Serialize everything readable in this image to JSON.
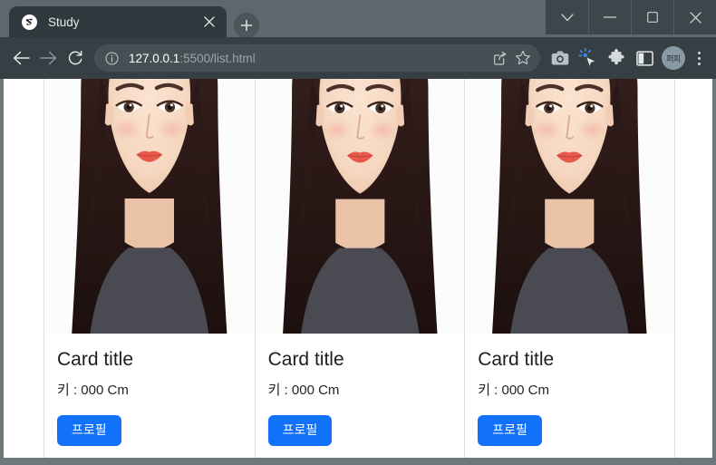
{
  "window": {
    "controls": [
      {
        "name": "chevron-down",
        "label": "⌄"
      },
      {
        "name": "minimize",
        "label": "—"
      },
      {
        "name": "maximize",
        "label": "□"
      },
      {
        "name": "close",
        "label": "✕"
      }
    ]
  },
  "tab": {
    "title": "Study",
    "favicon": "swirl-s-icon",
    "close_label": "✕",
    "new_tab_label": "+"
  },
  "toolbar": {
    "back": "back-arrow-icon",
    "forward": "forward-arrow-icon",
    "reload": "reload-icon",
    "omnibox": {
      "info_icon": "info-circle-icon",
      "url_host": "127.0.0.1",
      "url_path": ":5500/list.html",
      "full_url": "127.0.0.1:5500/list.html",
      "share_icon": "share-icon",
      "bookmark_icon": "star-icon"
    },
    "actions": [
      {
        "name": "camera-icon",
        "title": "Screenshot"
      },
      {
        "name": "cursor-click-icon",
        "title": "Select"
      },
      {
        "name": "puzzle-icon",
        "title": "Extensions"
      },
      {
        "name": "side-panel-icon",
        "title": "Side panel"
      }
    ],
    "avatar_label": "퍼피",
    "menu_label": "⋮"
  },
  "page": {
    "cards": [
      {
        "image": "portrait-woman-illustration",
        "title": "Card title",
        "text": "키 : 000 Cm",
        "button": "프로필"
      },
      {
        "image": "portrait-woman-illustration",
        "title": "Card title",
        "text": "키 : 000 Cm",
        "button": "프로필"
      },
      {
        "image": "portrait-woman-illustration",
        "title": "Card title",
        "text": "키 : 000 Cm",
        "button": "프로필"
      }
    ]
  },
  "colors": {
    "tabstrip": "#5f676c",
    "toolbar": "#353f44",
    "active_tab": "#2f383d",
    "primary_button": "#1271fb",
    "card_border": "#dcdcdc"
  }
}
